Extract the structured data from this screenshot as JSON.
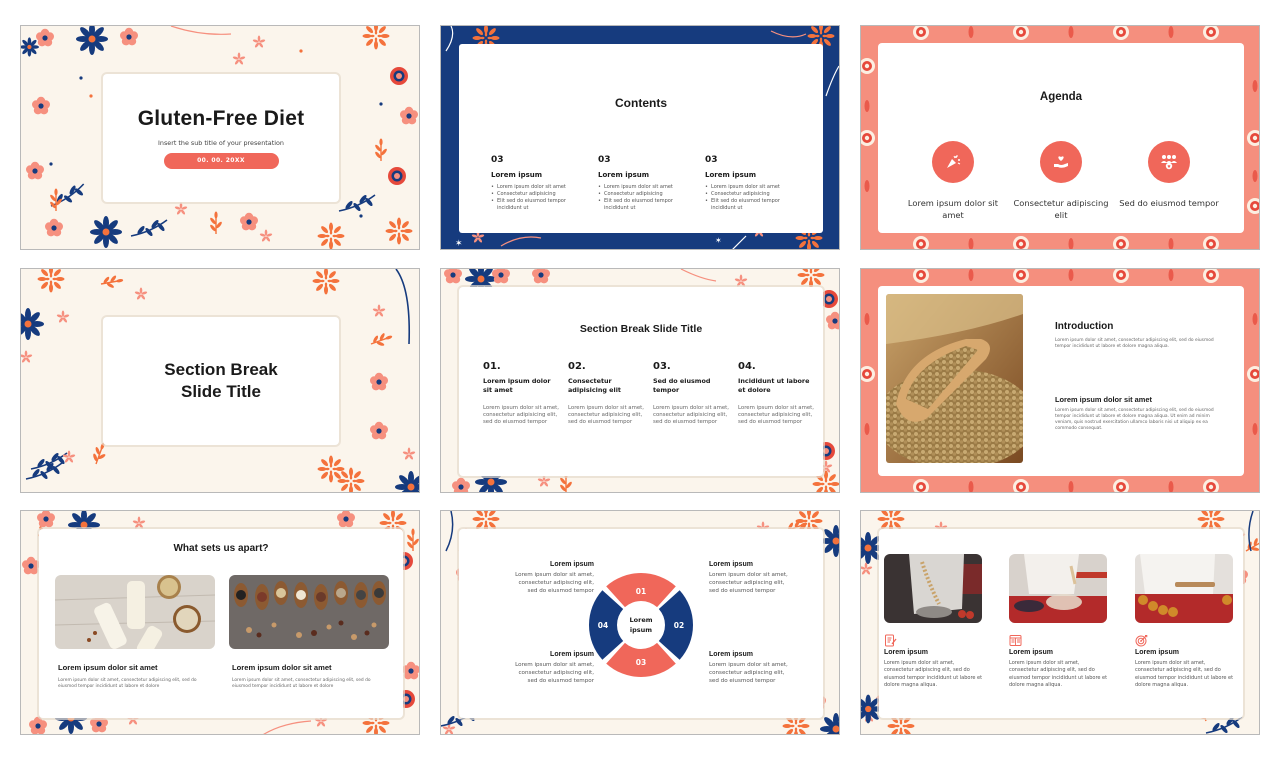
{
  "colors": {
    "coral": "#f0675a",
    "navy": "#163b7e",
    "cream": "#fbf5ec",
    "salmon_frame": "#f58f7e",
    "orange": "#f4723c",
    "pink": "#f6907f"
  },
  "slides": [
    {
      "id": 1,
      "title": "Gluten-Free Diet",
      "subtitle": "Insert the sub title of your presentation",
      "date": "00. 00. 20XX"
    },
    {
      "id": 2,
      "title": "Contents",
      "columns": [
        {
          "number": "03",
          "heading": "Lorem ipsum",
          "bullets": [
            "Lorem ipsum dolor sit amet",
            "Consectetur adipisicing",
            "Elit sed do eiusmod tempor incididunt ut"
          ]
        },
        {
          "number": "03",
          "heading": "Lorem ipsum",
          "bullets": [
            "Lorem ipsum dolor sit amet",
            "Consectetur adipisicing",
            "Elit sed do eiusmod tempor incididunt ut"
          ]
        },
        {
          "number": "03",
          "heading": "Lorem ipsum",
          "bullets": [
            "Lorem ipsum dolor sit amet",
            "Consectetur adipisicing",
            "Elit sed do eiusmod tempor incididunt ut"
          ]
        }
      ]
    },
    {
      "id": 3,
      "title": "Agenda",
      "items": [
        {
          "icon": "party-popper-icon",
          "label": "Lorem ipsum dolor sit amet"
        },
        {
          "icon": "heart-in-hand-icon",
          "label": "Consectetur adipiscing elit"
        },
        {
          "icon": "team-heart-icon",
          "label": "Sed do eiusmod tempor"
        }
      ]
    },
    {
      "id": 4,
      "title_line1": "Section Break",
      "title_line2": "Slide Title"
    },
    {
      "id": 5,
      "title": "Section Break Slide Title",
      "columns": [
        {
          "number": "01.",
          "heading": "Lorem ipsum dolor sit amet",
          "body": "Lorem ipsum dolor sit amet, consectetur adipisicing elit, sed do eiusmod tempor"
        },
        {
          "number": "02.",
          "heading": "Consectetur adipisicing elit",
          "body": "Lorem ipsum dolor sit amet, consectetur adipisicing elit, sed do eiusmod tempor"
        },
        {
          "number": "03.",
          "heading": "Sed do eiusmod tempor",
          "body": "Lorem ipsum dolor sit amet, consectetur adipisicing elit, sed do eiusmod tempor"
        },
        {
          "number": "04.",
          "heading": "Incididunt ut labore et dolore",
          "body": "Lorem ipsum dolor sit amet, consectetur adipisicing elit, sed do eiusmod tempor"
        }
      ]
    },
    {
      "id": 6,
      "image": "buckwheat-scoop-photo",
      "title": "Introduction",
      "intro_body": "Lorem ipsum dolor sit amet, consectetur adipiscing elit, sed do eiusmod tempor incididunt ut labore et dolore magna aliqua.",
      "section_title": "Lorem ipsum dolor sit amet",
      "section_body": "Lorem ipsum dolor sit amet, consectetur adipiscing elit, sed do eiusmod tempor incididunt ut labore et dolore magna aliqua. Ut enim ad minim veniam, quis nostrud exercitation ullamco laboris nisi ut aliquip ex ea commodo consequat."
    },
    {
      "id": 7,
      "title": "What sets us apart?",
      "columns": [
        {
          "image": "plant-milk-bottles-photo",
          "heading": "Lorem ipsum dolor sit amet",
          "body": "Lorem ipsum dolor sit amet, consectetur adipiscing elit, sed do eiusmod tempor incididunt ut labore et dolore"
        },
        {
          "image": "grains-in-spoons-photo",
          "heading": "Lorem ipsum dolor sit amet",
          "body": "Lorem ipsum dolor sit amet, consectetur adipiscing elit, sed do eiusmod tempor incididunt ut labore et dolore"
        }
      ]
    },
    {
      "id": 8,
      "center_label_line1": "Lorem",
      "center_label_line2": "ipsum",
      "segments": [
        "01",
        "02",
        "03",
        "04"
      ],
      "blocks": [
        {
          "heading": "Lorem ipsum",
          "body_l1": "Lorem ipsum dolor sit amet,",
          "body_l2": "consectetur adipiscing elit,",
          "body_l3": "sed do eiusmod tempor"
        },
        {
          "heading": "Lorem ipsum",
          "body_l1": "Lorem ipsum dolor sit amet,",
          "body_l2": "consectetur adipiscing elit,",
          "body_l3": "sed do eiusmod tempor"
        },
        {
          "heading": "Lorem ipsum",
          "body_l1": "Lorem ipsum dolor sit amet,",
          "body_l2": "consectetur adipiscing elit,",
          "body_l3": "sed do eiusmod tempor"
        },
        {
          "heading": "Lorem ipsum",
          "body_l1": "Lorem ipsum dolor sit amet,",
          "body_l2": "consectetur adipiscing elit,",
          "body_l3": "sed do eiusmod tempor"
        }
      ]
    },
    {
      "id": 9,
      "columns": [
        {
          "image": "tossing-flour-photo",
          "icon": "document-edit-icon",
          "heading": "Lorem ipsum",
          "body": "Lorem ipsum dolor sit amet, consectetur adipiscing elit, sed do eiusmod tempor incididunt ut labore et dolore magna aliqua."
        },
        {
          "image": "pouring-into-bowl-photo",
          "icon": "browser-layout-icon",
          "heading": "Lorem ipsum",
          "body": "Lorem ipsum dolor sit amet, consectetur adipiscing elit, sed do eiusmod tempor incididunt ut labore et dolore magna aliqua."
        },
        {
          "image": "rolling-dough-photo",
          "icon": "target-icon",
          "heading": "Lorem ipsum",
          "body": "Lorem ipsum dolor sit amet, consectetur adipiscing elit, sed do eiusmod tempor incididunt ut labore et dolore magna aliqua."
        }
      ]
    }
  ]
}
